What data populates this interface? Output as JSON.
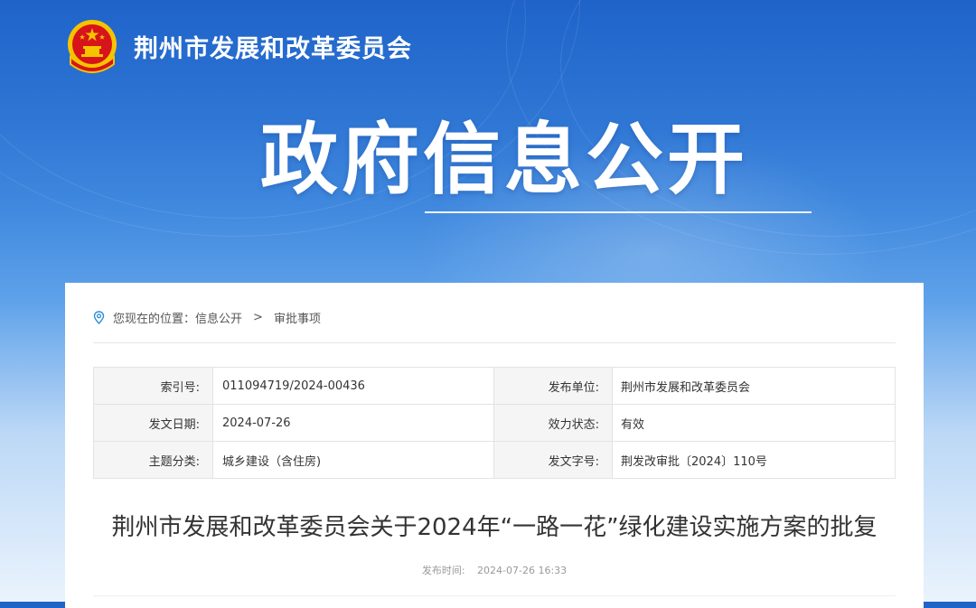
{
  "header": {
    "site_name": "荆州市发展和改革委员会",
    "emblem_icon": "national-emblem-icon"
  },
  "hero": {
    "title": "政府信息公开"
  },
  "breadcrumb": {
    "prefix": "您现在的位置：",
    "items": [
      "信息公开",
      "审批事项"
    ],
    "separator": ">",
    "icon": "location-pin-icon"
  },
  "meta": {
    "index_label": "索引号:",
    "index_value": "011094719/2024-00436",
    "publisher_label": "发布单位:",
    "publisher_value": "荆州市发展和改革委员会",
    "issue_date_label": "发文日期:",
    "issue_date_value": "2024-07-26",
    "status_label": "效力状态:",
    "status_value": "有效",
    "topic_label": "主题分类:",
    "topic_value": "城乡建设（含住房)",
    "doc_no_label": "发文字号:",
    "doc_no_value": "荆发改审批〔2024〕110号"
  },
  "document": {
    "title": "荆州市发展和改革委员会关于2024年“一路一花”绿化建设实施方案的批复",
    "publish_time_label": "发布时间:",
    "publish_time_value": "2024-07-26 16:33"
  },
  "colors": {
    "banner_top": "#1f63c9",
    "banner_bottom": "#eaf3fd",
    "accent": "#2b8fd6",
    "emblem_red": "#d7141a",
    "emblem_gold": "#f5c400"
  }
}
